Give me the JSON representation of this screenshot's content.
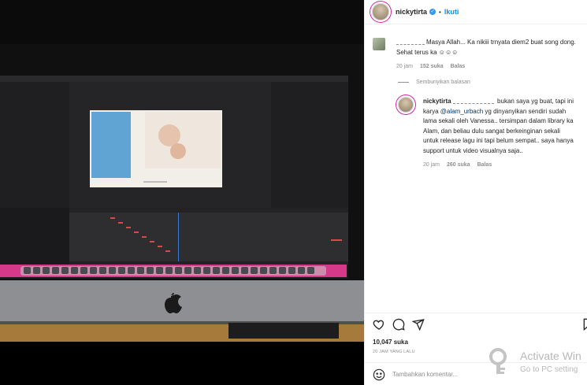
{
  "post": {
    "username": "nickytirta",
    "follow_label": "Ikuti",
    "separator": "•",
    "likes": "10,047 suka",
    "time": "20 JAM YANG LALU"
  },
  "comments": [
    {
      "text_before": "Masya Allah... Ka nikiii trnyata diem2 buat song dong. Sehat terus ka ☺☺☺",
      "time": "20 jam",
      "likes": "152 suka",
      "reply_label": "Balas"
    }
  ],
  "hide_replies_label": "Sembunyikan balasan",
  "reply": {
    "username": "nickytirta",
    "text_a": "bukan saya yg buat, tapi ini karya",
    "mention": "@alam_urbach",
    "text_b": "yg dinyanyikan sendiri sudah lama sekali oleh Vanessa.. tersimpan dalam library ka Alam, dan beliau dulu sangat berkeinginan sekali untuk release lagu ini tapi belum sempat.. saya hanya support untuk video visualnya saja..",
    "time": "20 jam",
    "likes": "260 suka",
    "reply_label": "Balas"
  },
  "comment_input": {
    "placeholder": "Tambahkan komentar..."
  },
  "watermark": {
    "title": "Activate Win",
    "subtitle": "Go to PC setting"
  },
  "icons": {
    "verified": "verified-badge-icon",
    "like": "heart-icon",
    "comment": "comment-bubble-icon",
    "share": "paper-plane-icon",
    "save": "bookmark-icon",
    "emoji": "smiley-icon"
  },
  "colors": {
    "link": "#0095f6",
    "mention": "#00376b",
    "muted": "#8e8e8e"
  }
}
